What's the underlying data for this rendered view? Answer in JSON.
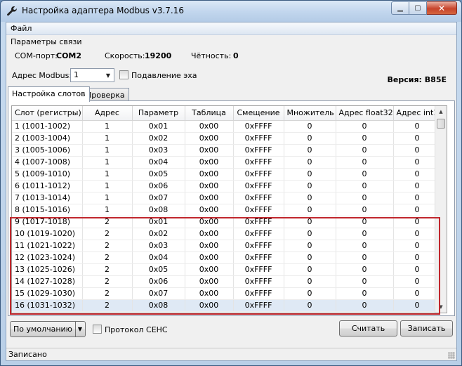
{
  "window": {
    "title": "Настройка адаптера Modbus v3.7.16",
    "minimize_label": "▁",
    "maximize_label": "▢",
    "close_label": "✕"
  },
  "menu": {
    "file": "Файл"
  },
  "connection": {
    "group_label": "Параметры связи",
    "com_label": "COM-порт:",
    "com_value": "COM2",
    "speed_label": "Скорость:",
    "speed_value": "19200",
    "parity_label": "Чётность:",
    "parity_value": "0",
    "modbus_addr_label": "Адрес Modbus:",
    "modbus_addr_value": "1",
    "echo_label": "Подавление эха",
    "echo_checked": false,
    "version_label": "Версия: B85E"
  },
  "tabs": [
    {
      "label": "Настройка слотов",
      "active": true
    },
    {
      "label": "Проверка",
      "active": false
    }
  ],
  "table": {
    "headers": [
      "Слот (регистры)",
      "Адрес",
      "Параметр",
      "Таблица",
      "Смещение",
      "Множитель",
      "Адрес float32",
      "Адрес int16"
    ],
    "rows": [
      [
        "1 (1001-1002)",
        "1",
        "0x01",
        "0x00",
        "0xFFFF",
        "0",
        "0",
        "0"
      ],
      [
        "2 (1003-1004)",
        "1",
        "0x02",
        "0x00",
        "0xFFFF",
        "0",
        "0",
        "0"
      ],
      [
        "3 (1005-1006)",
        "1",
        "0x03",
        "0x00",
        "0xFFFF",
        "0",
        "0",
        "0"
      ],
      [
        "4 (1007-1008)",
        "1",
        "0x04",
        "0x00",
        "0xFFFF",
        "0",
        "0",
        "0"
      ],
      [
        "5 (1009-1010)",
        "1",
        "0x05",
        "0x00",
        "0xFFFF",
        "0",
        "0",
        "0"
      ],
      [
        "6 (1011-1012)",
        "1",
        "0x06",
        "0x00",
        "0xFFFF",
        "0",
        "0",
        "0"
      ],
      [
        "7 (1013-1014)",
        "1",
        "0x07",
        "0x00",
        "0xFFFF",
        "0",
        "0",
        "0"
      ],
      [
        "8 (1015-1016)",
        "1",
        "0x08",
        "0x00",
        "0xFFFF",
        "0",
        "0",
        "0"
      ],
      [
        "9 (1017-1018)",
        "2",
        "0x01",
        "0x00",
        "0xFFFF",
        "0",
        "0",
        "0"
      ],
      [
        "10 (1019-1020)",
        "2",
        "0x02",
        "0x00",
        "0xFFFF",
        "0",
        "0",
        "0"
      ],
      [
        "11 (1021-1022)",
        "2",
        "0x03",
        "0x00",
        "0xFFFF",
        "0",
        "0",
        "0"
      ],
      [
        "12 (1023-1024)",
        "2",
        "0x04",
        "0x00",
        "0xFFFF",
        "0",
        "0",
        "0"
      ],
      [
        "13 (1025-1026)",
        "2",
        "0x05",
        "0x00",
        "0xFFFF",
        "0",
        "0",
        "0"
      ],
      [
        "14 (1027-1028)",
        "2",
        "0x06",
        "0x00",
        "0xFFFF",
        "0",
        "0",
        "0"
      ],
      [
        "15 (1029-1030)",
        "2",
        "0x07",
        "0x00",
        "0xFFFF",
        "0",
        "0",
        "0"
      ],
      [
        "16 (1031-1032)",
        "2",
        "0x08",
        "0x00",
        "0xFFFF",
        "0",
        "0",
        "0"
      ]
    ],
    "selected_row": 15,
    "highlight_color": "#c1272d"
  },
  "bottom": {
    "default_button": "По умолчанию",
    "ceh_label": "Протокол CEHC",
    "ceh_checked": false,
    "read_button": "Считать",
    "write_button": "Записать"
  },
  "status": {
    "text": "Записано"
  }
}
